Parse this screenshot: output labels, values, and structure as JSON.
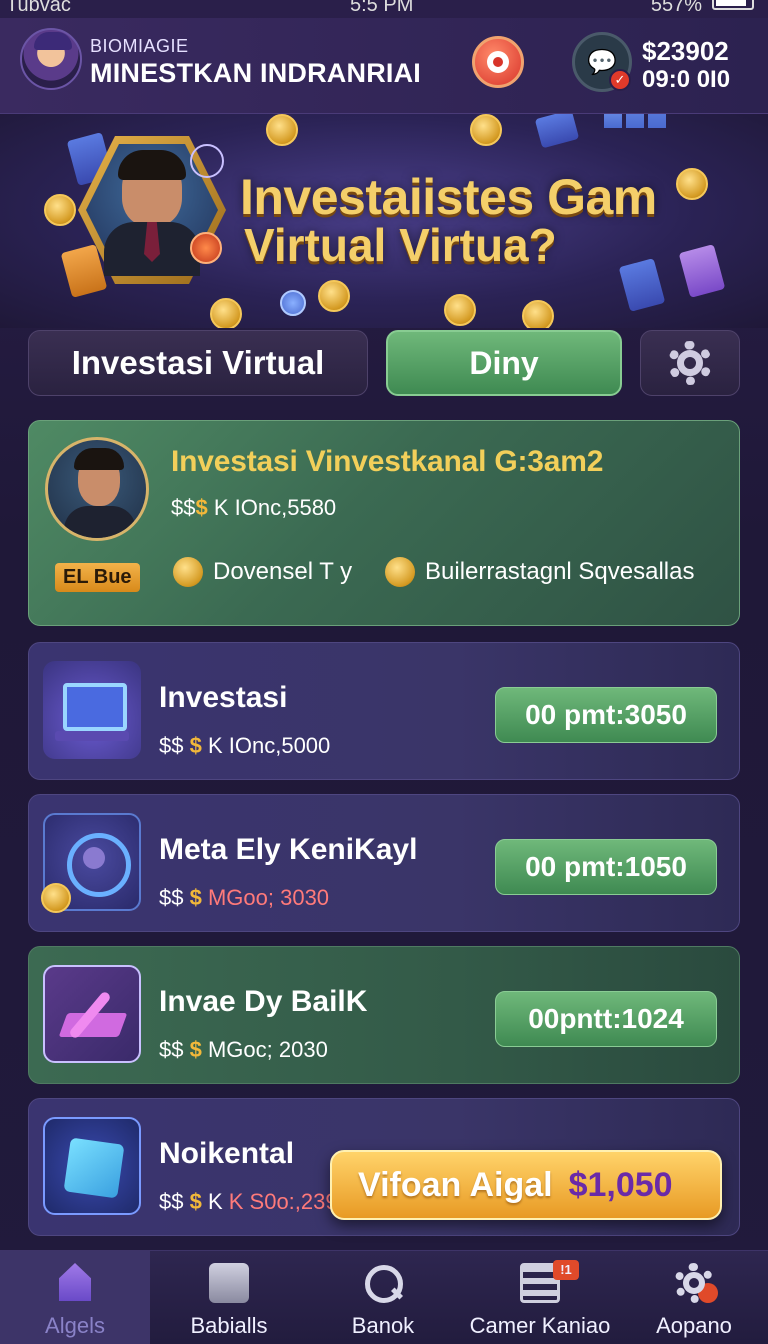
{
  "status_bar": {
    "carrier": "Tubvac",
    "time": "5:5 PM",
    "battery": "557%"
  },
  "header": {
    "subtitle": "BIOMIAGIE",
    "title": "MINESTKAN INDRANRIAI",
    "balance": "$23902",
    "balance_sub": "09:0 0I0"
  },
  "hero": {
    "line1": "Investaiistes Gam",
    "line2": "Virtual Virtua?"
  },
  "tabs": [
    {
      "label": "Investasi Virtual"
    },
    {
      "label": "Diny"
    }
  ],
  "featured": {
    "tag": "EL Bue",
    "title": "Investasi Vinvestkanal G:3am2",
    "price_prefix": "$$",
    "price_dollar": "$",
    "price_value": "K IOnc,5580",
    "meta1": "Dovensel T y",
    "meta2": "Builerrastagnl Sqvesallas"
  },
  "items": [
    {
      "name": "Investasi",
      "price_value": "K IOnc,5000",
      "pill": "00 pmt:3050",
      "icon": "monitor-icon"
    },
    {
      "name": "Meta Ely KeniKayl",
      "price_value": "MGoo; 3030",
      "pill": "00 pmt:1050",
      "icon": "person-icon"
    },
    {
      "name": "Invae Dy BailK",
      "price_value": "MGoc; 2030",
      "pill": "00pntt:1024",
      "icon": "chart-icon"
    },
    {
      "name": "Noikental",
      "price_value": "K S0o:,2390",
      "pill": "",
      "icon": "cube-icon"
    }
  ],
  "float_banner": {
    "label": "Vifoan Aigal",
    "amount": "$1,050"
  },
  "nav": [
    {
      "label": "Algels",
      "icon": "home-icon"
    },
    {
      "label": "Babialls",
      "icon": "wallet-icon"
    },
    {
      "label": "Banok",
      "icon": "search-icon"
    },
    {
      "label": "Camer Kaniao",
      "icon": "list-icon",
      "badge": "!1"
    },
    {
      "label": "Aopano",
      "icon": "gear-icon"
    }
  ],
  "colors": {
    "accent_green": "#4f8a64",
    "gold": "#f2cf5a",
    "bg": "#1f1838"
  }
}
